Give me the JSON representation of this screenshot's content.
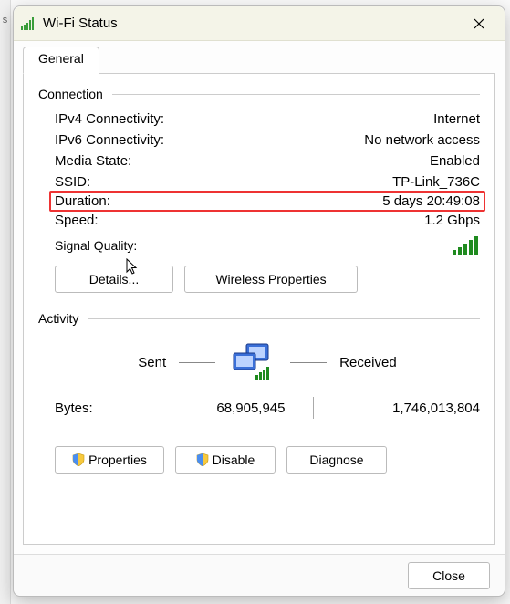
{
  "window": {
    "title": "Wi-Fi Status"
  },
  "tab": {
    "general": "General"
  },
  "connection": {
    "group_label": "Connection",
    "ipv4_label": "IPv4 Connectivity:",
    "ipv4_value": "Internet",
    "ipv6_label": "IPv6 Connectivity:",
    "ipv6_value": "No network access",
    "media_label": "Media State:",
    "media_value": "Enabled",
    "ssid_label": "SSID:",
    "ssid_value": "TP-Link_736C",
    "duration_label": "Duration:",
    "duration_value": "5 days 20:49:08",
    "speed_label": "Speed:",
    "speed_value": "1.2 Gbps",
    "signal_label": "Signal Quality:"
  },
  "buttons": {
    "details": "Details...",
    "wireless_properties": "Wireless Properties",
    "properties": "Properties",
    "disable": "Disable",
    "diagnose": "Diagnose",
    "close": "Close"
  },
  "activity": {
    "group_label": "Activity",
    "sent_label": "Sent",
    "received_label": "Received",
    "bytes_label": "Bytes:",
    "bytes_sent": "68,905,945",
    "bytes_received": "1,746,013,804"
  },
  "left_strip_char": "s"
}
